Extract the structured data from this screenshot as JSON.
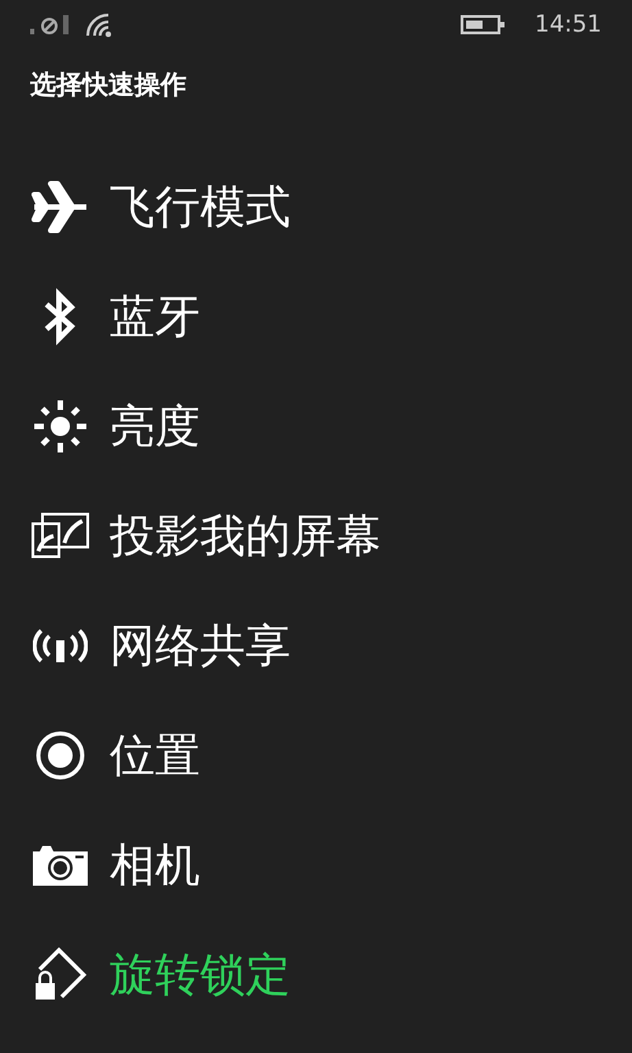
{
  "status_bar": {
    "time": "14:51"
  },
  "title": "选择快速操作",
  "actions": [
    {
      "kind": "airplane",
      "label": "飞行模式",
      "selected": false
    },
    {
      "kind": "bluetooth",
      "label": "蓝牙",
      "selected": false
    },
    {
      "kind": "brightness",
      "label": "亮度",
      "selected": false
    },
    {
      "kind": "project",
      "label": "投影我的屏幕",
      "selected": false
    },
    {
      "kind": "hotspot",
      "label": "网络共享",
      "selected": false
    },
    {
      "kind": "location",
      "label": "位置",
      "selected": false
    },
    {
      "kind": "camera",
      "label": "相机",
      "selected": false
    },
    {
      "kind": "rotation",
      "label": "旋转锁定",
      "selected": true
    }
  ]
}
